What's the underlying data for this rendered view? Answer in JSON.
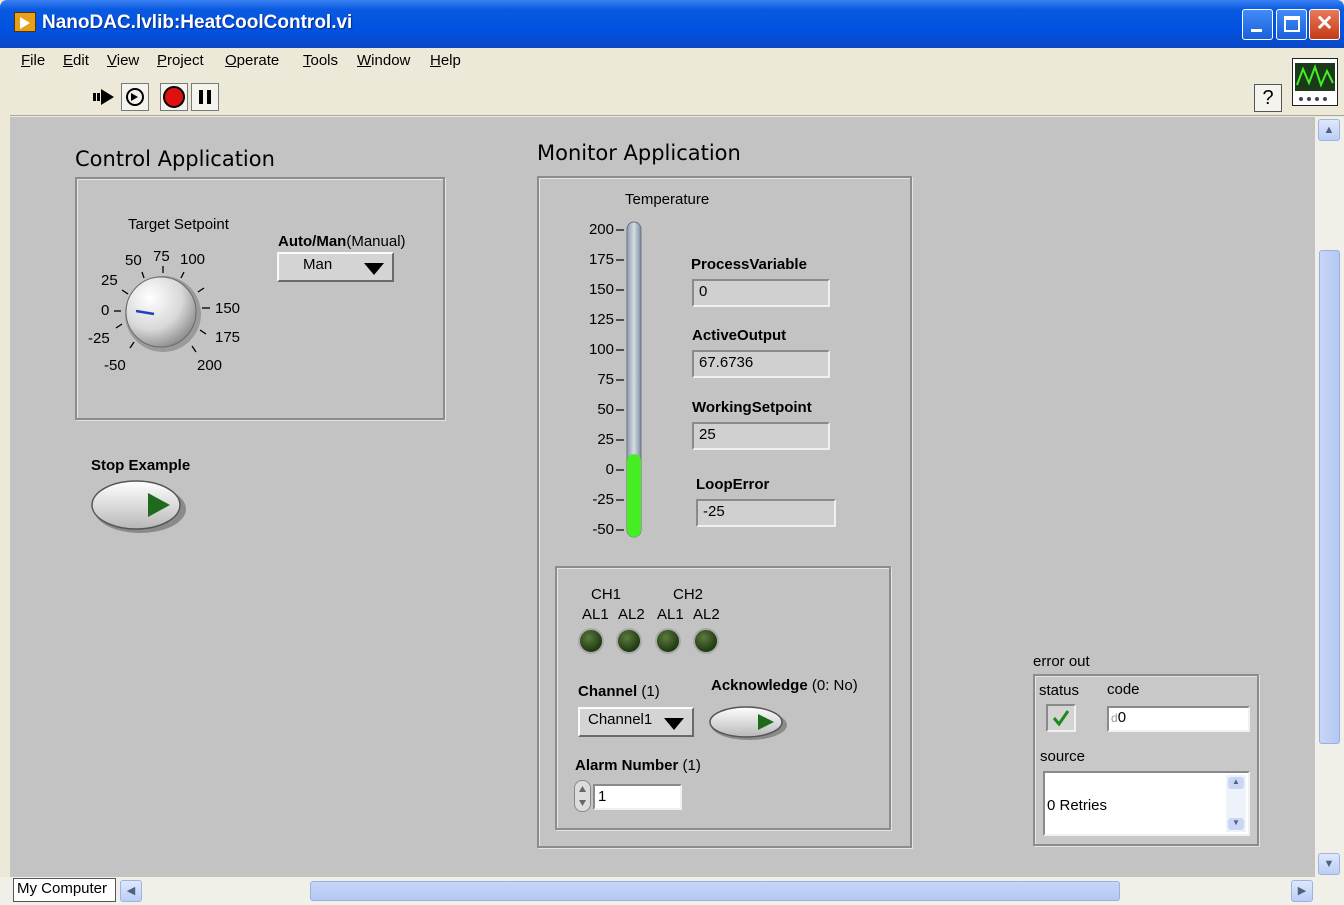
{
  "window": {
    "title": "NanoDAC.lvlib:HeatCoolControl.vi",
    "close_glyph": "✕"
  },
  "menu": [
    "File",
    "Edit",
    "View",
    "Project",
    "Operate",
    "Tools",
    "Window",
    "Help"
  ],
  "toolbar": {
    "buttons": [
      "run-arrow-icon",
      "run-continuously-icon",
      "abort-icon",
      "pause-icon"
    ],
    "help_glyph": "?"
  },
  "control_app": {
    "title": "Control Application",
    "setpoint_label": "Target Setpoint",
    "dial_ticks": [
      "-50",
      "-25",
      "0",
      "25",
      "50",
      "75",
      "100",
      "150",
      "175",
      "200"
    ],
    "automan_label_bold": "Auto/Man",
    "automan_label_rest": "(Manual)",
    "automan_value": "Man",
    "stop_label": "Stop Example"
  },
  "monitor_app": {
    "title": "Monitor Application",
    "thermo_label": "Temperature",
    "scale_ticks": [
      "200",
      "175",
      "150",
      "125",
      "100",
      "75",
      "50",
      "25",
      "0",
      "-25",
      "-50"
    ],
    "level_fraction": 0.27,
    "fill_color": "#44ee22",
    "fields": [
      {
        "label": "ProcessVariable",
        "value": "0"
      },
      {
        "label": "ActiveOutput",
        "value": "67.6736"
      },
      {
        "label": "WorkingSetpoint",
        "value": "25"
      },
      {
        "label": "LoopError",
        "value": "-25"
      }
    ],
    "alarms": {
      "ch1": "CH1",
      "ch2": "CH2",
      "leds": [
        "AL1",
        "AL2",
        "AL1",
        "AL2"
      ],
      "channel_label_bold": "Channel",
      "channel_label_rest": "(1)",
      "channel_value": "Channel1",
      "ack_label_bold": "Acknowledge",
      "ack_label_rest": "(0: No)",
      "alarm_number_label_bold": "Alarm Number",
      "alarm_number_label_rest": "(1)",
      "alarm_number_value": "1"
    }
  },
  "error_out": {
    "title": "error out",
    "status_label": "status",
    "code_label": "code",
    "code_prefix": "d",
    "code_value": "0",
    "source_label": "source",
    "source_value": "0 Retries"
  },
  "statusbar": {
    "context": "My Computer"
  }
}
